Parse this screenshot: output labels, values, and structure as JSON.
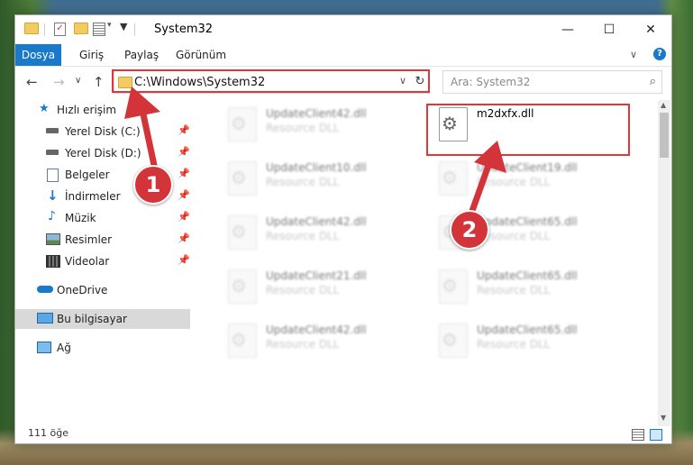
{
  "window": {
    "title": "System32",
    "controls": {
      "minimize": "—",
      "maximize": "☐",
      "close": "✕"
    }
  },
  "ribbon": {
    "tabs": [
      "Dosya",
      "Giriş",
      "Paylaş",
      "Görünüm"
    ],
    "toggle": "∨",
    "help": "?"
  },
  "address": {
    "path": "C:\\Windows\\System32",
    "back": "←",
    "forward": "→",
    "recent": "∨",
    "up": "↑",
    "refresh": "↻",
    "dropdown": "∨"
  },
  "search": {
    "placeholder": "Ara: System32",
    "icon": "search-icon"
  },
  "nav": {
    "items": [
      {
        "label": "Hızlı erişim",
        "icon": "star-icon",
        "pinned": false
      },
      {
        "label": "Yerel Disk (C:)",
        "icon": "drive-icon",
        "pinned": true
      },
      {
        "label": "Yerel Disk (D:)",
        "icon": "drive-icon",
        "pinned": true
      },
      {
        "label": "Belgeler",
        "icon": "documents-icon",
        "pinned": true
      },
      {
        "label": "İndirmeler",
        "icon": "downloads-icon",
        "pinned": true
      },
      {
        "label": "Müzik",
        "icon": "music-icon",
        "pinned": true
      },
      {
        "label": "Resimler",
        "icon": "pictures-icon",
        "pinned": true
      },
      {
        "label": "Videolar",
        "icon": "videos-icon",
        "pinned": true
      },
      {
        "label": "OneDrive",
        "icon": "cloud-icon",
        "pinned": false
      },
      {
        "label": "Bu bilgisayar",
        "icon": "computer-icon",
        "pinned": false,
        "selected": true
      },
      {
        "label": "Ağ",
        "icon": "network-icon",
        "pinned": false
      }
    ]
  },
  "files": [
    {
      "name": "UpdateClient42.dll",
      "type": "Resource DLL"
    },
    {
      "name": "m2dxfx.dll",
      "type": ""
    },
    {
      "name": "UpdateClient10.dll",
      "type": "Resource DLL"
    },
    {
      "name": "UpdateClient19.dll",
      "type": "Resource DLL"
    },
    {
      "name": "UpdateClient42.dll",
      "type": "Resource DLL"
    },
    {
      "name": "UpdateClient65.dll",
      "type": "Resource DLL"
    },
    {
      "name": "UpdateClient21.dll",
      "type": "Resource DLL"
    },
    {
      "name": "UpdateClient65.dll",
      "type": "Resource DLL"
    },
    {
      "name": "UpdateClient42.dll",
      "type": "Resource DLL"
    },
    {
      "name": "UpdateClient65.dll",
      "type": "Resource DLL"
    }
  ],
  "status": {
    "item_count": "111 öğe"
  },
  "annotations": {
    "step1": "1",
    "step2": "2",
    "highlight_color": "#e0373b"
  },
  "colors": {
    "accent": "#1979ca",
    "selection": "#d9d9d9"
  }
}
